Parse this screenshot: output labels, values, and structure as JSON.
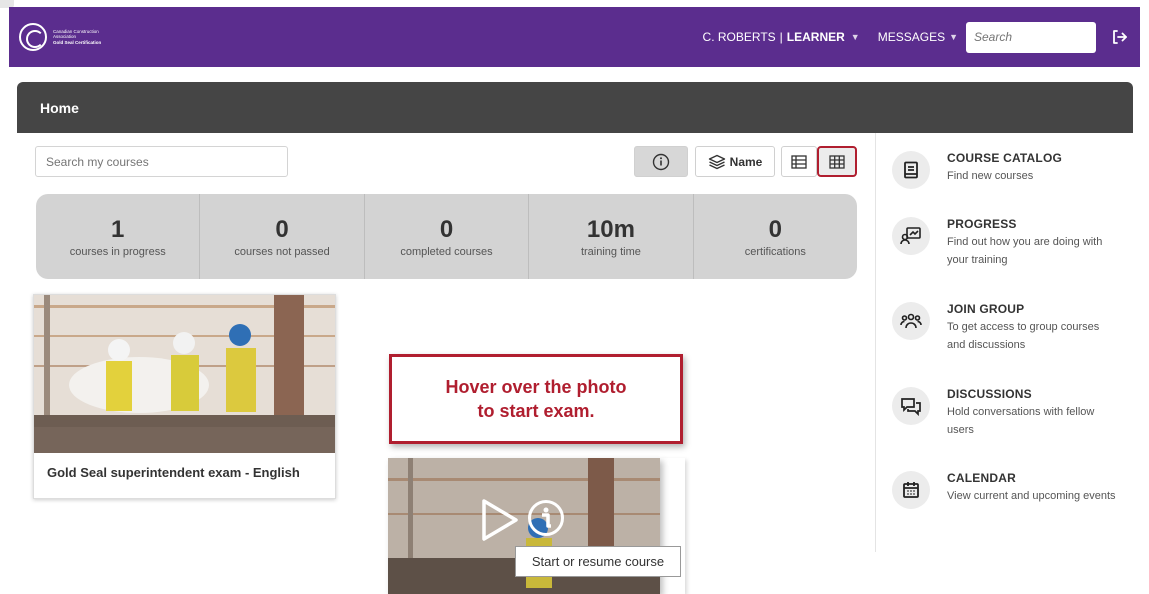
{
  "brand": {
    "org_line1": "Canadian Construction",
    "org_line2": "Association",
    "org_line3": "Gold Seal Certification"
  },
  "topbar": {
    "user_name": "C. ROBERTS",
    "separator": "|",
    "user_role": "LEARNER",
    "messages_label": "MESSAGES",
    "search_placeholder": "Search",
    "color": "#5b2d8e"
  },
  "page": {
    "title": "Home",
    "search_placeholder": "Search my courses"
  },
  "toolbar": {
    "sort_label": "Name"
  },
  "stats": [
    {
      "value": "1",
      "label": "courses in progress"
    },
    {
      "value": "0",
      "label": "courses not passed"
    },
    {
      "value": "0",
      "label": "completed courses"
    },
    {
      "value": "10m",
      "label": "training time"
    },
    {
      "value": "0",
      "label": "certifications"
    }
  ],
  "courses": [
    {
      "title": "Gold Seal superintendent exam - English"
    }
  ],
  "sidebar": {
    "items": [
      {
        "title": "COURSE CATALOG",
        "desc": "Find new courses",
        "icon": "book-icon"
      },
      {
        "title": "PROGRESS",
        "desc": "Find out how you are doing with your training",
        "icon": "progress-icon"
      },
      {
        "title": "JOIN GROUP",
        "desc": "To get access to group courses and discussions",
        "icon": "group-icon"
      },
      {
        "title": "DISCUSSIONS",
        "desc": "Hold conversations with fellow users",
        "icon": "chat-icon"
      },
      {
        "title": "CALENDAR",
        "desc": "View current and upcoming events",
        "icon": "calendar-icon"
      }
    ]
  },
  "callout": {
    "line1": "Hover over the photo",
    "line2": "to start exam."
  },
  "tooltip": {
    "text": "Start or resume course"
  },
  "colors": {
    "accent_red": "#b01e2f",
    "header_dark": "#454545"
  }
}
